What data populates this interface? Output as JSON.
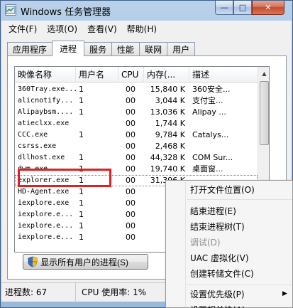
{
  "window": {
    "title": "Windows 任务管理器",
    "min_label": "—",
    "max_label": "□",
    "close_label": "✕"
  },
  "menu": [
    "文件(F)",
    "选项(O)",
    "查看(V)",
    "帮助(H)"
  ],
  "tabs": [
    {
      "label": "应用程序",
      "active": false
    },
    {
      "label": "进程",
      "active": true
    },
    {
      "label": "服务",
      "active": false
    },
    {
      "label": "性能",
      "active": false
    },
    {
      "label": "联网",
      "active": false
    },
    {
      "label": "用户",
      "active": false
    }
  ],
  "columns": [
    "映像名称",
    "用户名",
    "CPU",
    "内存(...",
    "描述"
  ],
  "rows": [
    {
      "name": "360Tray.exe...",
      "user": "1",
      "cpu": "00",
      "mem": "15,840 K",
      "desc": "360安全..."
    },
    {
      "name": "alicnotify...",
      "user": "1",
      "cpu": "00",
      "mem": "3,044 K",
      "desc": "支付宝..."
    },
    {
      "name": "Alipaybsm....",
      "user": "1",
      "cpu": "00",
      "mem": "13,036 K",
      "desc": "Alipay ..."
    },
    {
      "name": "atieclxx.exe",
      "user": "",
      "cpu": "00",
      "mem": "1,744 K",
      "desc": ""
    },
    {
      "name": "CCC.exe",
      "user": "1",
      "cpu": "00",
      "mem": "9,784 K",
      "desc": "Catalys..."
    },
    {
      "name": "csrss.exe",
      "user": "",
      "cpu": "00",
      "mem": "2,468 K",
      "desc": ""
    },
    {
      "name": "dllhost.exe",
      "user": "1",
      "cpu": "00",
      "mem": "44,328 K",
      "desc": "COM Sur..."
    },
    {
      "name": "dwm.exe",
      "user": "1",
      "cpu": "00",
      "mem": "19,740 K",
      "desc": "桌面窗..."
    },
    {
      "name": "explorer.exe",
      "user": "1",
      "cpu": "00",
      "mem": "31,396 K",
      "desc": "",
      "selected": true
    },
    {
      "name": "HD-Agent.exe",
      "user": "1",
      "cpu": "00",
      "mem": "",
      "desc": ""
    },
    {
      "name": "iexplore.exe",
      "user": "1",
      "cpu": "00",
      "mem": "",
      "desc": ""
    },
    {
      "name": "iexplore.e...",
      "user": "1",
      "cpu": "00",
      "mem": "",
      "desc": ""
    },
    {
      "name": "iexplore.e...",
      "user": "1",
      "cpu": "00",
      "mem": "",
      "desc": ""
    },
    {
      "name": "iexplore.e...",
      "user": "1",
      "cpu": "00",
      "mem": "",
      "desc": ""
    }
  ],
  "show_all_button": "显示所有用户的进程(S)",
  "status": {
    "processes": "进程数: 67",
    "cpu": "CPU 使用率: 1%"
  },
  "context_menu": {
    "items": [
      {
        "label": "打开文件位置(O)",
        "disabled": false
      },
      {
        "label": "结束进程(E)",
        "disabled": false
      },
      {
        "label": "结束进程树(T)",
        "disabled": false
      },
      {
        "label": "调试(D)",
        "disabled": true
      },
      {
        "label": "UAC 虚拟化(V)",
        "disabled": false
      },
      {
        "label": "创建转储文件(C)",
        "disabled": false
      },
      {
        "label": "设置优先级(P)",
        "disabled": false,
        "submenu": true
      },
      {
        "label": "设置相关性(A)...",
        "disabled": false
      }
    ]
  },
  "colors": {
    "highlight_box": "#e02020",
    "titlebar": "#b9d1ea"
  }
}
